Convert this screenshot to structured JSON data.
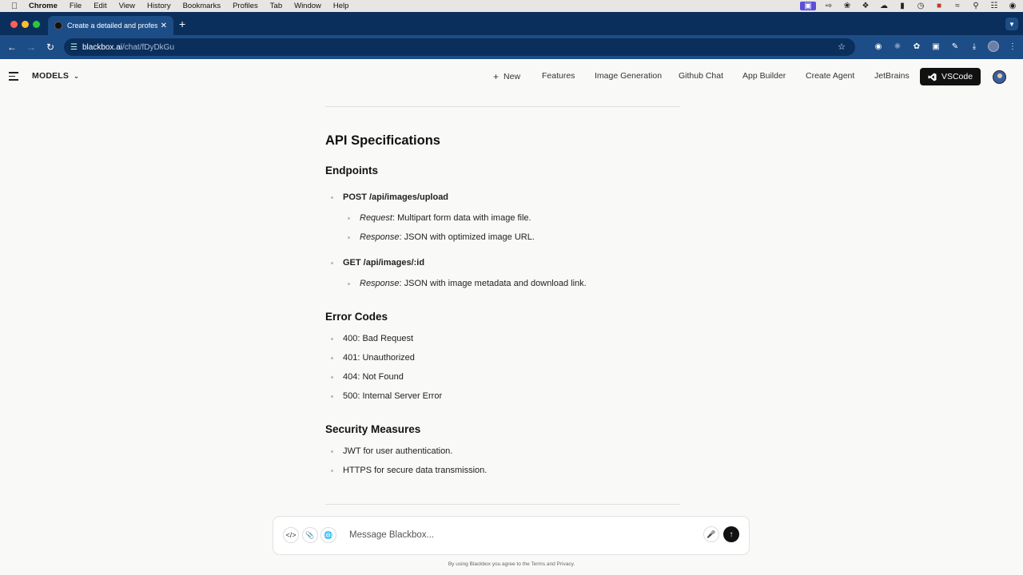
{
  "menubar": {
    "app": "Chrome",
    "items": [
      "File",
      "Edit",
      "View",
      "History",
      "Bookmarks",
      "Profiles",
      "Tab",
      "Window",
      "Help"
    ],
    "tray_icons": [
      "screen-share-icon",
      "arrow-icon",
      "leaf-icon",
      "dropbox-icon",
      "creative-cloud-icon",
      "battery-icon",
      "clock-icon",
      "red-app-icon",
      "wifi-icon",
      "search-icon",
      "control-center-icon",
      "siri-icon"
    ]
  },
  "browser": {
    "tab_title": "Create a detailed and professi",
    "url_host": "blackbox.ai",
    "url_path": "/chat/fDyDkGu"
  },
  "header": {
    "models_label": "MODELS",
    "nav": [
      {
        "label": "New",
        "icon": "plus-icon"
      },
      {
        "label": "Features"
      },
      {
        "label": "Image Generation"
      },
      {
        "label": "Github Chat"
      },
      {
        "label": "App Builder"
      },
      {
        "label": "Create Agent"
      },
      {
        "label": "JetBrains"
      }
    ],
    "vscode_label": "VSCode"
  },
  "doc": {
    "h_api": "API Specifications",
    "h_endpoints": "Endpoints",
    "ep1_title": "POST /api/images/upload",
    "ep1_req_label": "Request",
    "ep1_req_text": ": Multipart form data with image file.",
    "ep1_res_label": "Response",
    "ep1_res_text": ": JSON with optimized image URL.",
    "ep2_title": "GET /api/images/:id",
    "ep2_res_label": "Response",
    "ep2_res_text": ": JSON with image metadata and download link.",
    "h_errors": "Error Codes",
    "errors": [
      "400: Bad Request",
      "401: Unauthorized",
      "404: Not Found",
      "500: Internal Server Error"
    ],
    "h_security": "Security Measures",
    "security": [
      "JWT for user authentication.",
      "HTTPS for secure data transmission."
    ]
  },
  "composer": {
    "placeholder": "Message Blackbox...",
    "footer": "By using Blackbox you agree to the Terms and Privacy."
  }
}
